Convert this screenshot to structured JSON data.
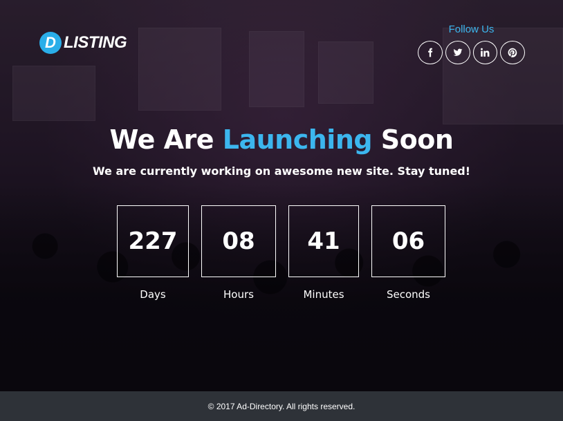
{
  "brand": {
    "logo_letter": "D",
    "logo_text": "LISTING",
    "accent_color": "#3cb6ee"
  },
  "follow": {
    "title": "Follow Us",
    "icons": [
      "facebook-icon",
      "twitter-icon",
      "linkedin-icon",
      "pinterest-icon"
    ]
  },
  "hero": {
    "title_start": "We Are ",
    "title_accent": "Launching",
    "title_end": " Soon",
    "subtitle": "We are currently working on awesome new site. Stay tuned!"
  },
  "countdown": [
    {
      "value": "227",
      "label": "Days"
    },
    {
      "value": "08",
      "label": "Hours"
    },
    {
      "value": "41",
      "label": "Minutes"
    },
    {
      "value": "06",
      "label": "Seconds"
    }
  ],
  "footer": {
    "copyright": "© 2017 Ad-Directory. All rights reserved."
  }
}
